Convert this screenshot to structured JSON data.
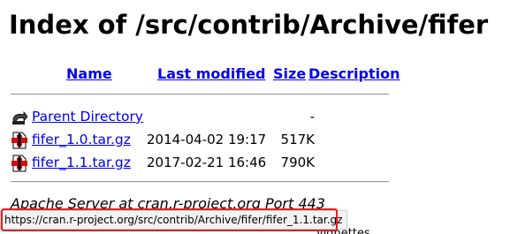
{
  "page": {
    "title": "Index of /src/contrib/Archive/fifer"
  },
  "table": {
    "headers": {
      "name": "Name",
      "last_modified": "Last modified",
      "size": "Size",
      "description": "Description"
    },
    "parent": {
      "label": "Parent Directory",
      "size": "-",
      "icon": "back-arrow-icon"
    },
    "rows": [
      {
        "name": "fifer_1.0.tar.gz",
        "date": "2014-04-02 19:17",
        "size": "517K",
        "icon": "compressed-file-icon"
      },
      {
        "name": "fifer_1.1.tar.gz",
        "date": "2017-02-21 16:46",
        "size": "790K",
        "icon": "compressed-file-icon"
      }
    ]
  },
  "footer": {
    "text": "Apache Server at cran.r-project.org Port 443"
  },
  "statusbar": {
    "url": "https://cran.r-project.org/src/contrib/Archive/fifer/fifer_1.1.tar.gz",
    "highlight_color": "#e02020"
  },
  "partial_text_below": "vignettes"
}
